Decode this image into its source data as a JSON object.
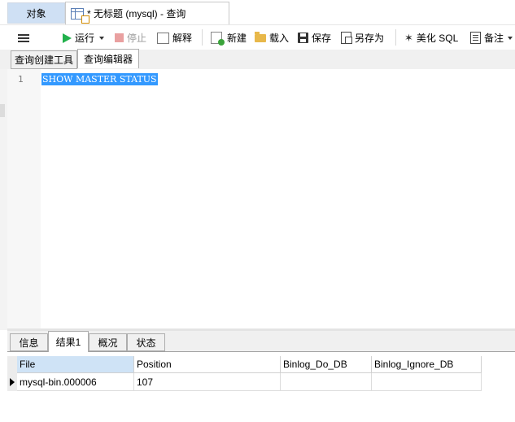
{
  "tabs": {
    "objects": "对象",
    "query": "* 无标题 (mysql) - 查询"
  },
  "toolbar": {
    "run": "运行",
    "stop": "停止",
    "explain": "解释",
    "new": "新建",
    "load": "载入",
    "save": "保存",
    "save_as": "另存为",
    "beautify_sql": "美化 SQL",
    "note": "备注"
  },
  "subtabs": {
    "builder": "查询创建工具",
    "editor": "查询编辑器"
  },
  "editor": {
    "line_number": "1",
    "sql": "SHOW MASTER STATUS"
  },
  "result_tabs": {
    "info": "信息",
    "result1": "结果1",
    "overview": "概况",
    "status": "状态"
  },
  "grid": {
    "columns": [
      "File",
      "Position",
      "Binlog_Do_DB",
      "Binlog_Ignore_DB"
    ],
    "rows": [
      [
        "mysql-bin.000006",
        "107",
        "",
        ""
      ]
    ]
  },
  "colors": {
    "selection": "#3399ff",
    "run_icon": "#22b14c",
    "active_tab": "#cfe0f4"
  }
}
